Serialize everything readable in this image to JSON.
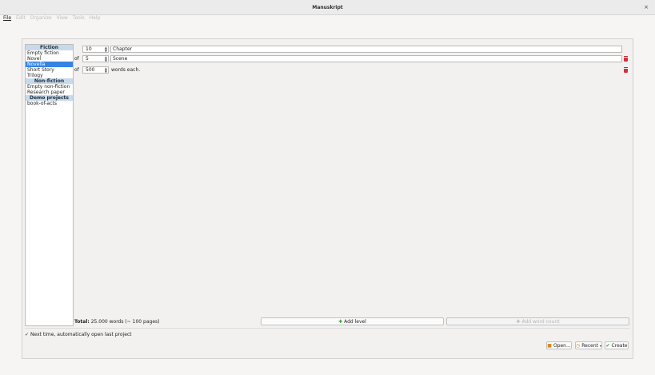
{
  "window": {
    "title": "Manuskript",
    "close_glyph": "×"
  },
  "menu": [
    {
      "label": "File",
      "active": true
    },
    {
      "label": "Edit",
      "active": false
    },
    {
      "label": "Organize",
      "active": false
    },
    {
      "label": "View",
      "active": false
    },
    {
      "label": "Tools",
      "active": false
    },
    {
      "label": "Help",
      "active": false
    }
  ],
  "templates": {
    "fiction_header": "Fiction",
    "fiction": [
      "Empty fiction",
      "Novel",
      "Novella",
      "Short Story",
      "Trilogy"
    ],
    "selected": "Novella",
    "nonfiction_header": "Non-fiction",
    "nonfiction": [
      "Empty non-fiction",
      "Research paper"
    ],
    "demo_header": "Demo projects",
    "demo": [
      "book-of-acts"
    ]
  },
  "levels": [
    {
      "prefix": "",
      "count": "10",
      "name": "Chapter"
    },
    {
      "prefix": "of",
      "count": "5",
      "name": "Scene"
    }
  ],
  "words": {
    "prefix": "of",
    "count": "500",
    "suffix": "words each."
  },
  "total": {
    "label": "Total:",
    "text": "25.000 words (~ 100 pages)"
  },
  "buttons": {
    "add_level": "Add level",
    "add_word_count": "Add word count",
    "open": "Open...",
    "recent": "Recent",
    "create": "Create"
  },
  "checkbox": {
    "label": "Next time, automatically open last project",
    "checked": true
  }
}
